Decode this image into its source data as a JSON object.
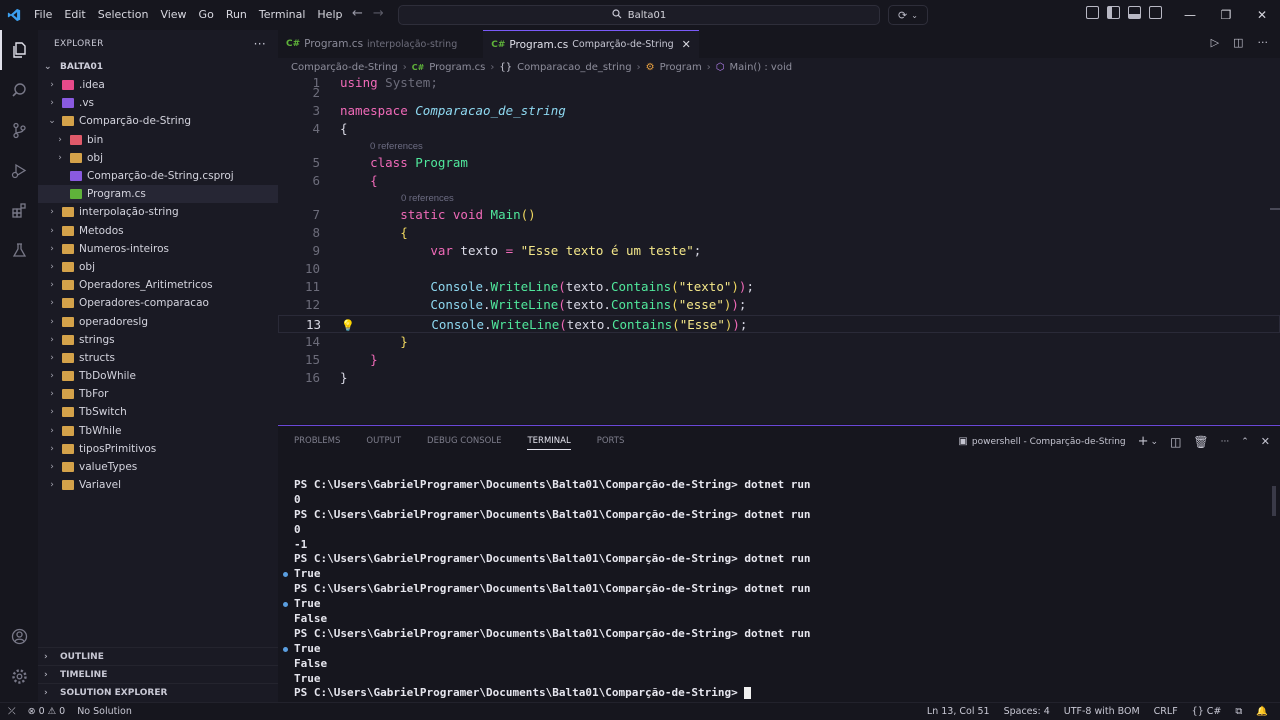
{
  "menu": [
    "File",
    "Edit",
    "Selection",
    "View",
    "Go",
    "Run",
    "Terminal",
    "Help"
  ],
  "command_center": {
    "label": "Balta01"
  },
  "sidebar": {
    "title": "EXPLORER",
    "workspace": "BALTA01",
    "items": [
      {
        "label": ".idea",
        "depth": 1,
        "chev": "right",
        "icon_color": "#e84a8a"
      },
      {
        "label": ".vs",
        "depth": 1,
        "chev": "right",
        "icon_color": "#8a5ae0"
      },
      {
        "label": "Comparção-de-String",
        "depth": 1,
        "chev": "down",
        "icon_color": "#d4a24a"
      },
      {
        "label": "bin",
        "depth": 2,
        "chev": "right",
        "icon_color": "#e05a6a"
      },
      {
        "label": "obj",
        "depth": 2,
        "chev": "right",
        "icon_color": "#d4a24a"
      },
      {
        "label": "Comparção-de-String.csproj",
        "depth": 2,
        "chev": "none",
        "icon_color": "#8a5ae0"
      },
      {
        "label": "Program.cs",
        "depth": 2,
        "chev": "none",
        "icon_color": "#5fb33a",
        "selected": true
      },
      {
        "label": "interpolação-string",
        "depth": 1,
        "chev": "right",
        "icon_color": "#d4a24a"
      },
      {
        "label": "Metodos",
        "depth": 1,
        "chev": "right",
        "icon_color": "#d4a24a"
      },
      {
        "label": "Numeros-inteiros",
        "depth": 1,
        "chev": "right",
        "icon_color": "#d4a24a"
      },
      {
        "label": "obj",
        "depth": 1,
        "chev": "right",
        "icon_color": "#d4a24a"
      },
      {
        "label": "Operadores_Aritimetricos",
        "depth": 1,
        "chev": "right",
        "icon_color": "#d4a24a"
      },
      {
        "label": "Operadores-comparacao",
        "depth": 1,
        "chev": "right",
        "icon_color": "#d4a24a"
      },
      {
        "label": "operadoreslg",
        "depth": 1,
        "chev": "right",
        "icon_color": "#d4a24a"
      },
      {
        "label": "strings",
        "depth": 1,
        "chev": "right",
        "icon_color": "#d4a24a"
      },
      {
        "label": "structs",
        "depth": 1,
        "chev": "right",
        "icon_color": "#d4a24a"
      },
      {
        "label": "TbDoWhile",
        "depth": 1,
        "chev": "right",
        "icon_color": "#d4a24a"
      },
      {
        "label": "TbFor",
        "depth": 1,
        "chev": "right",
        "icon_color": "#d4a24a"
      },
      {
        "label": "TbSwitch",
        "depth": 1,
        "chev": "right",
        "icon_color": "#d4a24a"
      },
      {
        "label": "TbWhile",
        "depth": 1,
        "chev": "right",
        "icon_color": "#d4a24a"
      },
      {
        "label": "tiposPrimitivos",
        "depth": 1,
        "chev": "right",
        "icon_color": "#d4a24a"
      },
      {
        "label": "valueTypes",
        "depth": 1,
        "chev": "right",
        "icon_color": "#d4a24a"
      },
      {
        "label": "Variavel",
        "depth": 1,
        "chev": "right",
        "icon_color": "#d4a24a"
      }
    ],
    "sections": [
      "OUTLINE",
      "TIMELINE",
      "SOLUTION EXPLORER"
    ]
  },
  "tabs": [
    {
      "label": "Program.cs",
      "desc": "interpolação-string",
      "active": false
    },
    {
      "label": "Program.cs",
      "desc": "Comparção-de-String",
      "active": true
    }
  ],
  "breadcrumb": [
    "Comparção-de-String",
    "Program.cs",
    "Comparacao_de_string",
    "Program",
    "Main() : void"
  ],
  "code": {
    "refs1": "0 references",
    "refs2": "0 references"
  },
  "panel": {
    "tabs": [
      "PROBLEMS",
      "OUTPUT",
      "DEBUG CONSOLE",
      "TERMINAL",
      "PORTS"
    ],
    "active_tab": "TERMINAL",
    "terminal_name": "powershell - Comparção-de-String",
    "lines": [
      {
        "text": "PS C:\\Users\\GabrielProgramer\\Documents\\Balta01\\Comparção-de-String> dotnet run",
        "dot": false
      },
      {
        "text": "0",
        "dot": false
      },
      {
        "text": "PS C:\\Users\\GabrielProgramer\\Documents\\Balta01\\Comparção-de-String> dotnet run",
        "dot": false
      },
      {
        "text": "0",
        "dot": false
      },
      {
        "text": "-1",
        "dot": false
      },
      {
        "text": "PS C:\\Users\\GabrielProgramer\\Documents\\Balta01\\Comparção-de-String> dotnet run",
        "dot": false
      },
      {
        "text": "True",
        "dot": true
      },
      {
        "text": "PS C:\\Users\\GabrielProgramer\\Documents\\Balta01\\Comparção-de-String> dotnet run",
        "dot": false
      },
      {
        "text": "True",
        "dot": true
      },
      {
        "text": "False",
        "dot": false
      },
      {
        "text": "PS C:\\Users\\GabrielProgramer\\Documents\\Balta01\\Comparção-de-String> dotnet run",
        "dot": false
      },
      {
        "text": "True",
        "dot": true
      },
      {
        "text": "False",
        "dot": false
      },
      {
        "text": "True",
        "dot": false
      },
      {
        "text": "PS C:\\Users\\GabrielProgramer\\Documents\\Balta01\\Comparção-de-String>",
        "dot": false,
        "cursor": true
      }
    ]
  },
  "status": {
    "errors": "0",
    "warnings": "0",
    "solution": "No Solution",
    "position": "Ln 13, Col 51",
    "spaces": "Spaces: 4",
    "encoding": "UTF-8 with BOM",
    "eol": "CRLF",
    "language": "C#"
  },
  "colors": {
    "accent": "#7a5af8",
    "background": "#1a1a24"
  }
}
